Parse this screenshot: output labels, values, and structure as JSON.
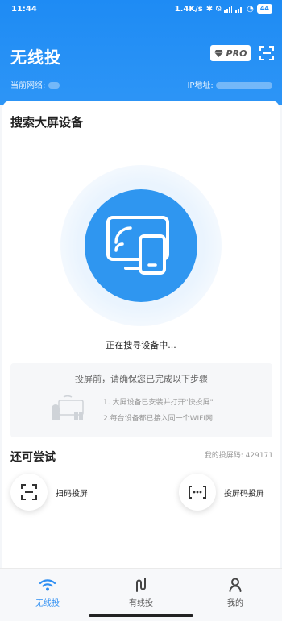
{
  "status": {
    "time": "11:44",
    "speed": "1.4K/s",
    "battery": "44"
  },
  "header": {
    "title": "无线投",
    "pro_label": "PRO",
    "network_label": "当前网络:",
    "ip_label": "IP地址:"
  },
  "search": {
    "title": "搜索大屏设备",
    "status": "正在搜寻设备中..."
  },
  "steps": {
    "title": "投屏前，请确保您已完成以下步骤",
    "items": [
      "1. 大屏设备已安装并打开\"快投屏\"",
      "2.每台设备都已接入同一个WIFI网"
    ]
  },
  "try": {
    "title": "还可尝试",
    "code_label": "我的投屏码: 429171",
    "actions": [
      {
        "label": "扫码投屏"
      },
      {
        "label": "投屏码投屏"
      }
    ]
  },
  "nav": {
    "tabs": [
      {
        "label": "无线投"
      },
      {
        "label": "有线投"
      },
      {
        "label": "我的"
      }
    ]
  },
  "colors": {
    "primary": "#2f8ff2",
    "header": "#1e8bf4"
  }
}
